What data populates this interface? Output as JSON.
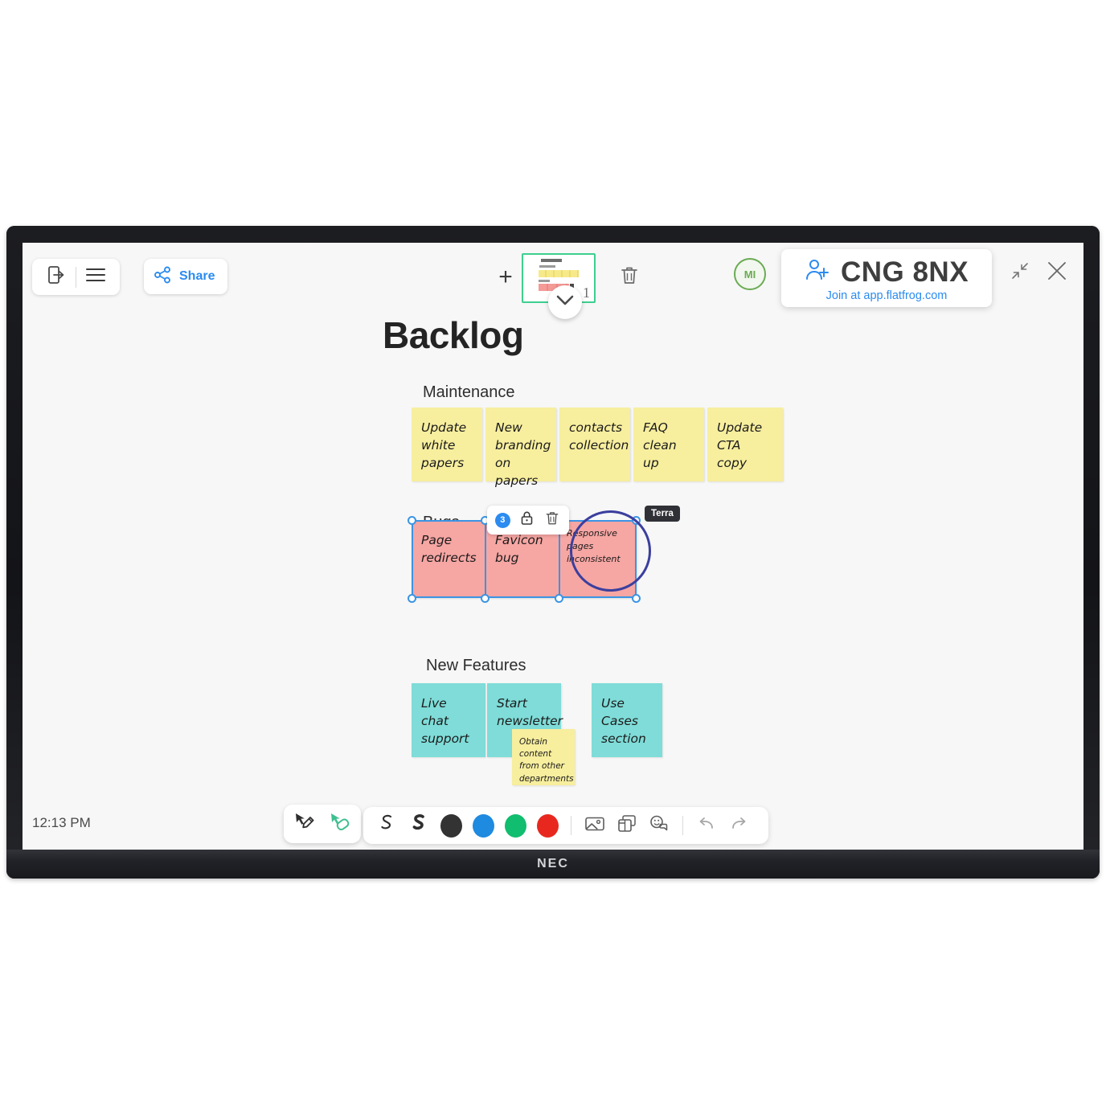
{
  "device": {
    "brand": "NEC"
  },
  "topbar": {
    "exit_icon": "exit-door-icon",
    "menu_icon": "hamburger-menu-icon",
    "share_label": "Share",
    "share_icon": "share-nodes-icon",
    "add_page_label": "+",
    "page_number": "1",
    "delete_page_icon": "trash-icon",
    "expand_icon": "chevron-down-icon",
    "avatar_initials": "MI",
    "session_code": "CNG 8NX",
    "session_join": "Join at app.flatfrog.com",
    "add_person_icon": "add-person-icon",
    "minimize_icon": "minimize-icon",
    "close_icon": "close-icon"
  },
  "board": {
    "title": "Backlog",
    "groups": [
      {
        "label": "Maintenance",
        "color": "#f7ee9e",
        "notes": [
          "Update white papers",
          "New branding on papers",
          "contacts collection",
          "FAQ clean up",
          "Update CTA copy"
        ]
      },
      {
        "label": "Bugs",
        "color": "#f6a6a3",
        "notes": [
          "Page redirects",
          "Favicon bug",
          "Responsive pages inconsistent"
        ],
        "selected_count": "3",
        "lock_icon": "lock-icon",
        "delete_icon": "trash-icon",
        "annotation_author": "Terra",
        "annotation_color": "#3b3f9e"
      },
      {
        "label": "New Features",
        "color": "#7fdcd8",
        "notes": [
          "Live chat support",
          "Start newsletter",
          "Use Cases section"
        ],
        "sticky_overlay": "Obtain content from other departments",
        "sticky_overlay_color": "#f7ee9e"
      }
    ]
  },
  "toolbar": {
    "pen_tool_icon": "pen-cursor-icon",
    "eraser_tool_icon": "eraser-cursor-icon",
    "stroke_thin_icon": "stroke-thin-icon",
    "stroke_thick_icon": "stroke-thick-icon",
    "colors": [
      {
        "name": "black",
        "hex": "#333333"
      },
      {
        "name": "blue",
        "hex": "#1e8ae0"
      },
      {
        "name": "green",
        "hex": "#11bd6e"
      },
      {
        "name": "red",
        "hex": "#e8281f"
      }
    ],
    "image_icon": "image-icon",
    "template_icon": "template-icon",
    "sticker_icon": "sticker-icon",
    "undo_icon": "undo-icon",
    "redo_icon": "redo-icon"
  },
  "status": {
    "clock": "12:13 PM"
  }
}
